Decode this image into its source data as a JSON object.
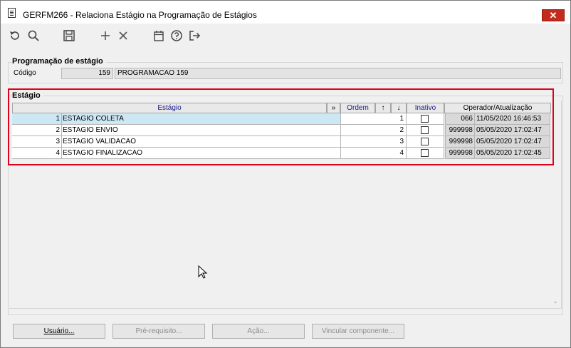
{
  "window": {
    "title": "GERFM266 - Relaciona Estágio na Programação de Estágios",
    "close": "✕"
  },
  "toolbar": {
    "icons": [
      "undo-icon",
      "search-icon",
      "save-icon",
      "add-icon",
      "delete-icon",
      "calendar-icon",
      "help-icon",
      "exit-icon"
    ]
  },
  "programacao": {
    "group_label": "Programação de estágio",
    "codigo_label": "Código",
    "codigo_value": "159",
    "descricao_value": "PROGRAMACAO 159"
  },
  "estagio": {
    "group_label": "Estágio",
    "headers": {
      "estagio": "Estágio",
      "expand": "»",
      "ordem": "Ordem",
      "up": "↑",
      "down": "↓",
      "inativo": "Inativo",
      "operador": "Operador/Atualização"
    },
    "rows": [
      {
        "num": "1",
        "nome": "ESTAGIO COLETA",
        "ordem": "1",
        "operador": "066",
        "data": "11/05/2020 16:46:53"
      },
      {
        "num": "2",
        "nome": "ESTAGIO ENVIO",
        "ordem": "2",
        "operador": "999998",
        "data": "05/05/2020 17:02:47"
      },
      {
        "num": "3",
        "nome": "ESTAGIO VALIDACAO",
        "ordem": "3",
        "operador": "999998",
        "data": "05/05/2020 17:02:47"
      },
      {
        "num": "4",
        "nome": "ESTAGIO FINALIZACAO",
        "ordem": "4",
        "operador": "999998",
        "data": "05/05/2020 17:02:45"
      }
    ]
  },
  "buttons": {
    "usuario": "Usuário...",
    "prerequisito": "Pré-requisito...",
    "acao": "Ação...",
    "vincular": "Vincular componente..."
  },
  "colors": {
    "highlight": "#e0001b",
    "selected_row": "#cce8f4",
    "close": "#c42b1c"
  }
}
